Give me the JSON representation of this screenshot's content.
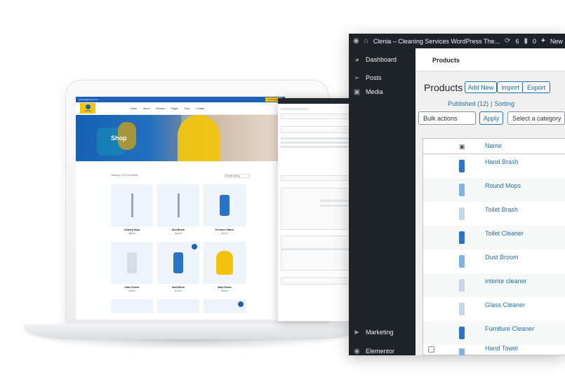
{
  "shop": {
    "topbar_left": "support@clenia.com",
    "topbar_right": "Get A Quote",
    "logo": "Clenia",
    "menu": [
      "Home",
      "About",
      "Services",
      "Pages",
      "Shop",
      "Contact"
    ],
    "hero_title": "Shop",
    "showing_text": "Showing 1–12 of 16 results",
    "sort_label": "Default sorting",
    "products": [
      {
        "name": "Cleaning Mops",
        "price": "$48.00"
      },
      {
        "name": "Dust Broom",
        "price": "$32.00"
      },
      {
        "name": "Furniture Cleaner",
        "price": "$21.00"
      },
      {
        "name": "Glass Cleaner",
        "price": "$18.00"
      },
      {
        "name": "Hand Brush",
        "price": "$12.00"
      },
      {
        "name": "Hand Gloves",
        "price": "$15.00"
      }
    ]
  },
  "wp": {
    "admin_bar": {
      "site_title": "Clenia – Cleaning Services WordPress The...",
      "updates_count": "6",
      "comments_count": "0",
      "new_label": "New"
    },
    "sidebar": [
      {
        "label": "Dashboard",
        "icon": "dashboard-icon"
      },
      {
        "label": "Posts",
        "icon": "pin-icon"
      },
      {
        "label": "Media",
        "icon": "media-icon"
      },
      {
        "label": "Marketing",
        "icon": "megaphone-icon"
      },
      {
        "label": "Elementor",
        "icon": "elementor-icon"
      }
    ],
    "page_tab": "Products",
    "title": "Products",
    "buttons": {
      "add_new": "Add New",
      "import": "Import",
      "export": "Export"
    },
    "sublinks": {
      "published": "Published (12)",
      "sorting": "Sorting"
    },
    "bulk_select": "Bulk actions",
    "apply": "Apply",
    "category_select": "Select a category",
    "col_name": "Name",
    "products": [
      "Hand Brash",
      "Round Mops",
      "Toilet Brash",
      "Toilet Cleaner",
      "Dust Broom",
      "interior cleaner",
      "Glass Cleaner",
      "Furniture Cleaner",
      "Hand Towel"
    ]
  },
  "colors": {
    "brand_blue": "#1b5fb6",
    "brand_yellow": "#f5c400",
    "wp_dark": "#1d2327",
    "wp_link": "#2271b1"
  }
}
